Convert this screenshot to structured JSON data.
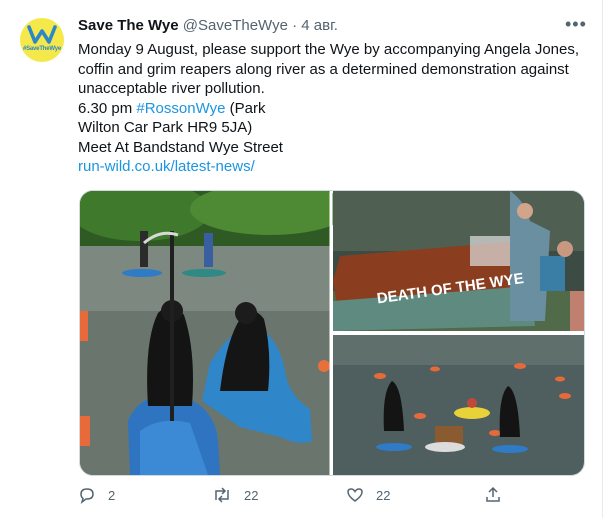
{
  "tweet": {
    "display_name": "Save The Wye",
    "handle": "@SaveTheWye",
    "separator": "·",
    "date": "4 авг.",
    "more_label": "•••",
    "avatar_text": "#SaveTheWye",
    "body_main": "Monday 9 August, please support the Wye by accompanying Angela Jones, coffin and grim reapers along river as a determined demonstration against unacceptable river pollution.",
    "time_text": "6.30 pm",
    "hashtag": "#RossonWye",
    "location_open": "(Park",
    "location_close": "Wilton Car Park HR9 5JA)",
    "meet_text": "Meet At Bandstand Wye Street",
    "link": "run-wild.co.uk/latest-news/"
  },
  "media": {
    "coffin_sign": "DEATH OF THE WYE"
  },
  "actions": {
    "reply_count": "2",
    "retweet_count": "22",
    "like_count": "22"
  },
  "colors": {
    "link": "#1b95e0",
    "secondary_text": "#536471",
    "avatar_bg": "#f5e84a"
  }
}
